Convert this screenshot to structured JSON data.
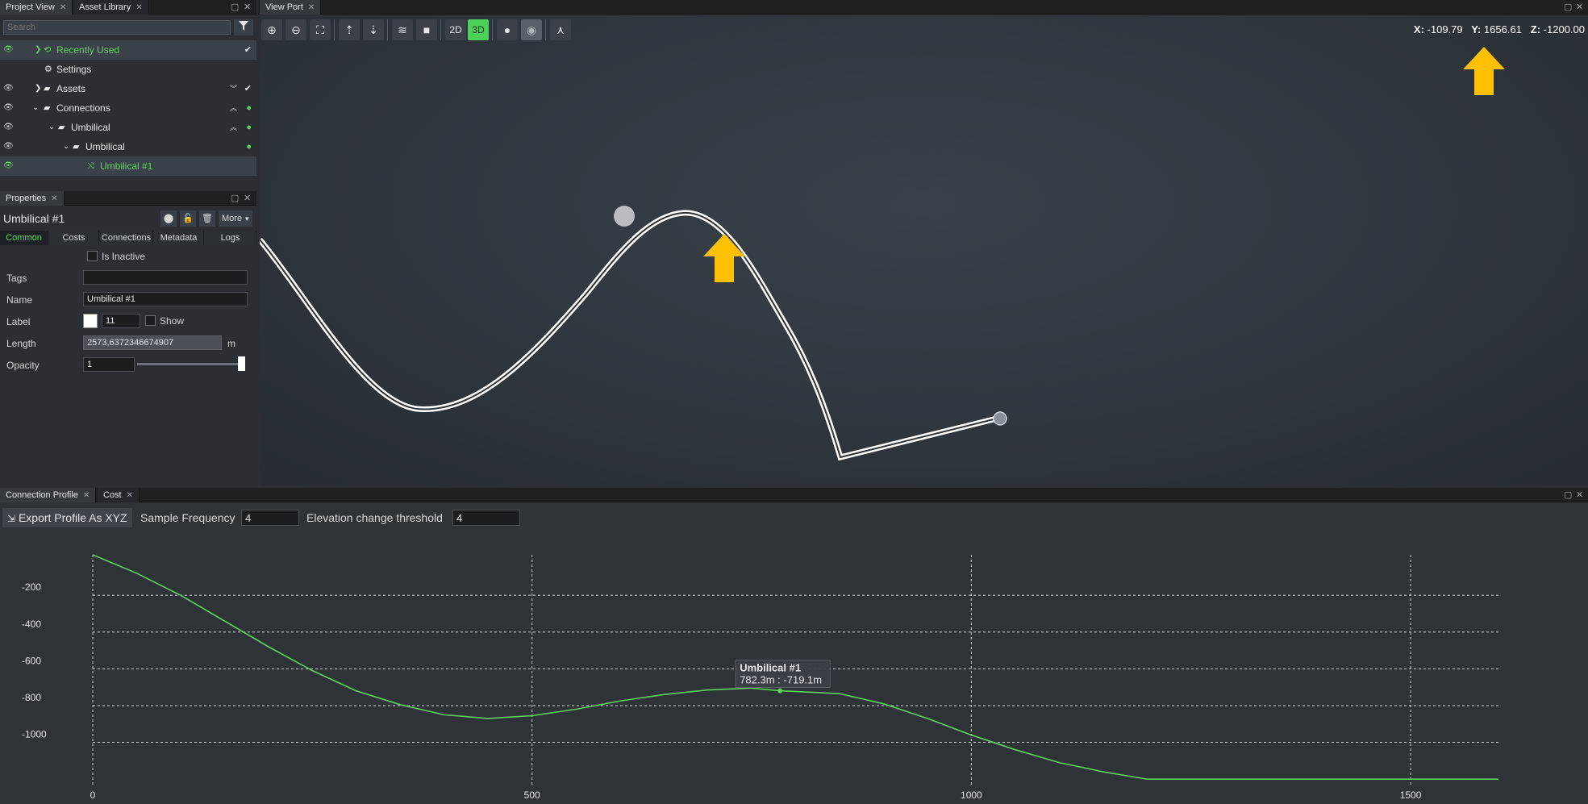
{
  "project_view": {
    "tabs": [
      "Project View",
      "Asset Library"
    ],
    "search_placeholder": "Search",
    "tree": [
      {
        "label": "Recently Used",
        "level": 1
      },
      {
        "label": "Settings",
        "level": 1
      },
      {
        "label": "Assets",
        "level": 1
      },
      {
        "label": "Connections",
        "level": 1
      },
      {
        "label": "Umbilical",
        "level": 2
      },
      {
        "label": "Umbilical",
        "level": 3
      },
      {
        "label": "Umbilical #1",
        "level": 4
      }
    ]
  },
  "properties": {
    "tab": "Properties",
    "title": "Umbilical #1",
    "more_label": "More",
    "tabs": [
      "Common",
      "Costs",
      "Connections",
      "Metadata",
      "Logs"
    ],
    "is_inactive_label": "Is Inactive",
    "tags_label": "Tags",
    "tags_value": "",
    "name_label": "Name",
    "name_value": "Umbilical #1",
    "label_label": "Label",
    "label_size": "11",
    "show_label": "Show",
    "length_label": "Length",
    "length_value": "2573,6372346674907",
    "length_unit": "m",
    "opacity_label": "Opacity",
    "opacity_value": "1",
    "opacity_fraction": 1.0
  },
  "viewport": {
    "tab": "View Port",
    "mode_2d": "2D",
    "mode_3d": "3D",
    "x_label": "X:",
    "x_value": "-109.79",
    "y_label": "Y:",
    "y_value": "1656.61",
    "z_label": "Z:",
    "z_value": "-1200.00"
  },
  "bottom": {
    "tabs": [
      "Connection Profile",
      "Cost"
    ],
    "export_label": "Export Profile As XYZ",
    "sample_frequency_label": "Sample Frequency",
    "sample_frequency_value": "4",
    "elevation_threshold_label": "Elevation change threshold",
    "elevation_threshold_value": "4"
  },
  "colors": {
    "accent_green": "#5fd35f",
    "arrow_yellow": "#ffc000",
    "panel_bg": "#2b2f33"
  },
  "chart_data": {
    "type": "line",
    "series": [
      {
        "name": "Umbilical #1",
        "x": [
          0,
          50,
          100,
          150,
          200,
          250,
          300,
          350,
          400,
          450,
          500,
          550,
          600,
          650,
          700,
          750,
          782.3,
          850,
          900,
          950,
          1000,
          1050,
          1100,
          1150,
          1200,
          1300,
          1400,
          1500,
          1600
        ],
        "y": [
          20,
          -80,
          -200,
          -340,
          -480,
          -610,
          -720,
          -795,
          -850,
          -870,
          -855,
          -820,
          -775,
          -740,
          -715,
          -705,
          -719.1,
          -735,
          -790,
          -870,
          -960,
          -1040,
          -1110,
          -1160,
          -1200,
          -1200,
          -1200,
          -1200,
          -1200
        ]
      }
    ],
    "xticks": [
      "0",
      "500",
      "1000",
      "1500"
    ],
    "yticks": [
      "-200",
      "-400",
      "-600",
      "-800",
      "-1000"
    ],
    "xlim": [
      0,
      1600
    ],
    "ylim": [
      -1230,
      20
    ],
    "grid": true,
    "tooltip": {
      "title": "Umbilical #1",
      "text": "782.3m : -719.1m",
      "x": 782.3,
      "y": -719.1
    }
  }
}
